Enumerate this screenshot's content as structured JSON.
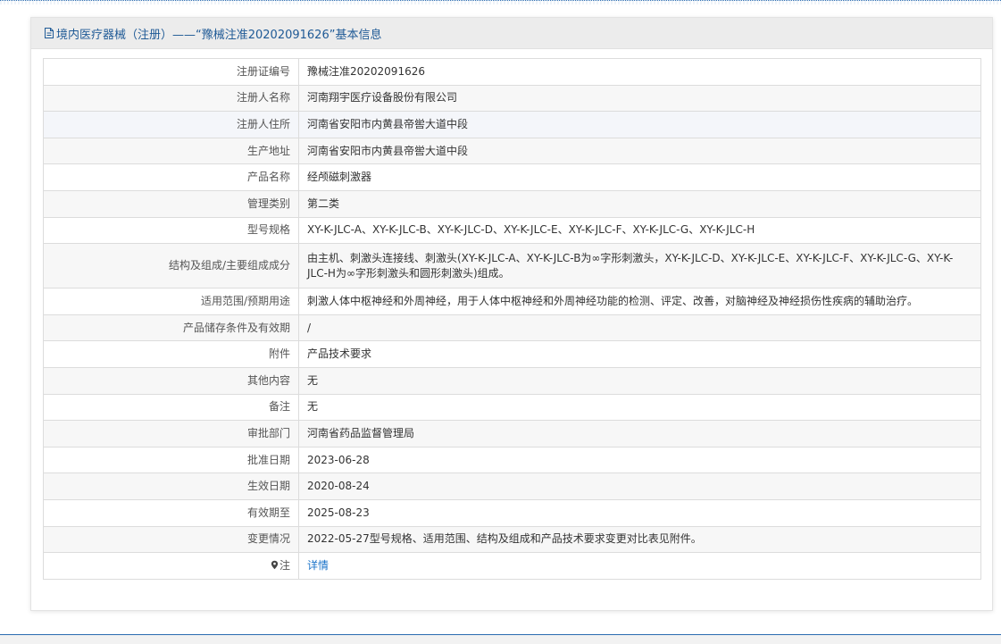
{
  "header": {
    "title": "境内医疗器械（注册）——“豫械注准20202091626”基本信息"
  },
  "rows": [
    {
      "label": "注册证编号",
      "value": "豫械注准20202091626"
    },
    {
      "label": "注册人名称",
      "value": "河南翔宇医疗设备股份有限公司"
    },
    {
      "label": "注册人住所",
      "value": "河南省安阳市内黄县帝喾大道中段"
    },
    {
      "label": "生产地址",
      "value": "河南省安阳市内黄县帝喾大道中段"
    },
    {
      "label": "产品名称",
      "value": "经颅磁刺激器"
    },
    {
      "label": "管理类别",
      "value": "第二类"
    },
    {
      "label": "型号规格",
      "value": "XY-K-JLC-A、XY-K-JLC-B、XY-K-JLC-D、XY-K-JLC-E、XY-K-JLC-F、XY-K-JLC-G、XY-K-JLC-H"
    },
    {
      "label": "结构及组成/主要组成成分",
      "value": "由主机、刺激头连接线、刺激头(XY-K-JLC-A、XY-K-JLC-B为∞字形刺激头，XY-K-JLC-D、XY-K-JLC-E、XY-K-JLC-F、XY-K-JLC-G、XY-K-JLC-H为∞字形刺激头和圆形刺激头)组成。"
    },
    {
      "label": "适用范围/预期用途",
      "value": "刺激人体中枢神经和外周神经，用于人体中枢神经和外周神经功能的检测、评定、改善，对脑神经及神经损伤性疾病的辅助治疗。"
    },
    {
      "label": "产品储存条件及有效期",
      "value": "/"
    },
    {
      "label": "附件",
      "value": "产品技术要求"
    },
    {
      "label": "其他内容",
      "value": "无"
    },
    {
      "label": "备注",
      "value": "无"
    },
    {
      "label": "审批部门",
      "value": "河南省药品监督管理局"
    },
    {
      "label": "批准日期",
      "value": "2023-06-28"
    },
    {
      "label": "生效日期",
      "value": "2020-08-24"
    },
    {
      "label": "有效期至",
      "value": "2025-08-23"
    },
    {
      "label": "变更情况",
      "value": "2022-05-27型号规格、适用范围、结构及组成和产品技术要求变更对比表见附件。"
    }
  ],
  "note": {
    "label": "注",
    "link_text": "详情",
    "icon": "pin-icon"
  },
  "colors": {
    "title": "#1f5a96",
    "link": "#1a73c9",
    "accent_rule": "#2b6cb0"
  }
}
